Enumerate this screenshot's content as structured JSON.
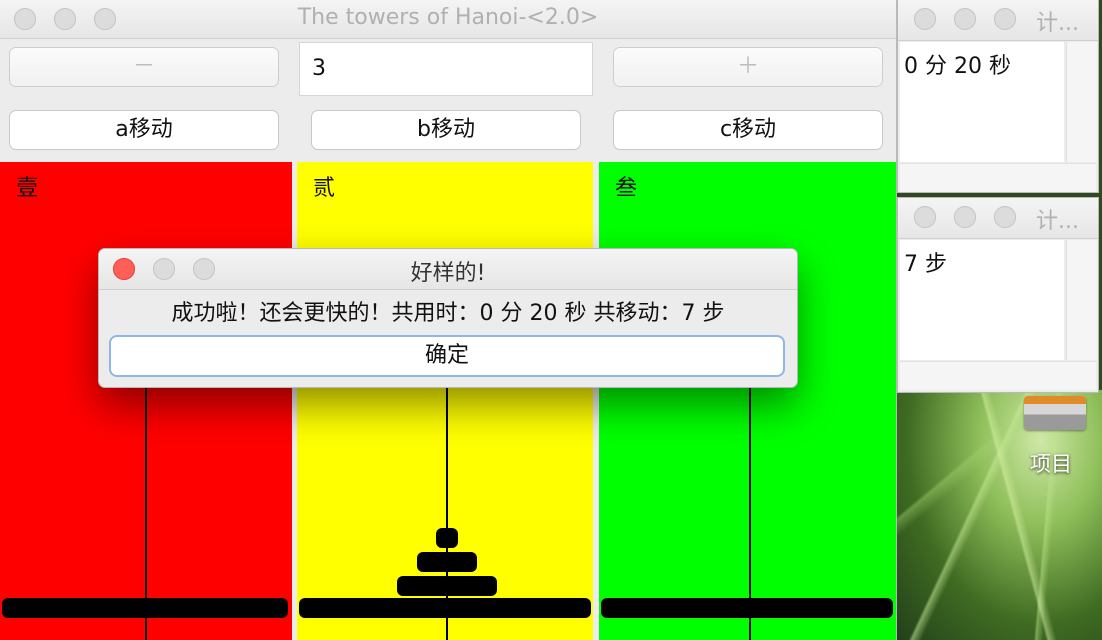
{
  "main_window": {
    "title": "The towers of Hanoi-<2.0>",
    "decrease_label": "－",
    "increase_label": "＋",
    "disk_count": "3",
    "move_buttons": [
      "a移动",
      "b移动",
      "c移动"
    ]
  },
  "towers": [
    {
      "label": "壹",
      "color": "#ff0000",
      "disk_count": 0
    },
    {
      "label": "贰",
      "color": "#ffff00",
      "disk_count": 3
    },
    {
      "label": "叁",
      "color": "#00ff00",
      "disk_count": 0
    }
  ],
  "timer_window": {
    "title": "计...",
    "value": "0 分 20 秒"
  },
  "steps_window": {
    "title": "计...",
    "value": "7  步"
  },
  "dialog": {
    "title": "好样的!",
    "message": "成功啦！还会更快的！共用时：0 分 20 秒 共移动：7  步",
    "ok_label": "确定",
    "close_color": "#ff5f57"
  },
  "desktop": {
    "item_label": "项目"
  }
}
